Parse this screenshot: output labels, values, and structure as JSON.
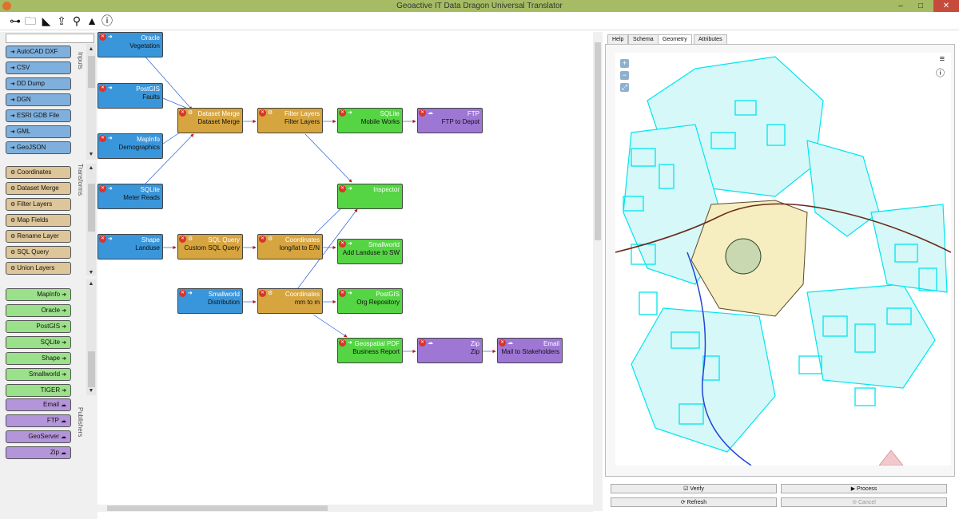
{
  "window": {
    "title": "Geoactive IT Data Dragon Universal Translator",
    "minimize": "–",
    "maximize": "□",
    "close": "✕"
  },
  "toolbar": {
    "icons": [
      "hierarchy-icon",
      "open-folder-icon",
      "eraser-icon",
      "upload-icon",
      "wrench-icon",
      "mortarboard-icon",
      "info-icon"
    ]
  },
  "palette": {
    "search_value": "",
    "inputs_label": "Inputs",
    "transforms_label": "Transforms",
    "publishers_label": "Publishers",
    "inputs": [
      "AutoCAD DXF",
      "CSV",
      "DD Dump",
      "DGN",
      "ESRI GDB File",
      "GML",
      "GeoJSON"
    ],
    "transforms": [
      "Coordinates",
      "Dataset Merge",
      "Filter Layers",
      "Map Fields",
      "Rename Layer",
      "SQL Query",
      "Union Layers"
    ],
    "outputs": [
      "MapInfo",
      "Oracle",
      "PostGIS",
      "SQLite",
      "Shape",
      "Smallworld",
      "TIGER"
    ],
    "publishers": [
      "Email",
      "FTP",
      "GeoServer",
      "Zip"
    ]
  },
  "workflow": {
    "nodes": [
      {
        "id": "oracle",
        "kind": "input",
        "type": "Oracle",
        "name": "Vegetation"
      },
      {
        "id": "postgis",
        "kind": "input",
        "type": "PostGIS",
        "name": "Faults"
      },
      {
        "id": "mapinfo",
        "kind": "input",
        "type": "MapInfo",
        "name": "Demographics"
      },
      {
        "id": "sqlite-in",
        "kind": "input",
        "type": "SQLite",
        "name": "Meter Reads"
      },
      {
        "id": "shape",
        "kind": "input",
        "type": "Shape",
        "name": "Landuse"
      },
      {
        "id": "merge",
        "kind": "transform",
        "type": "Dataset Merge",
        "name": "Dataset Merge"
      },
      {
        "id": "filter",
        "kind": "transform",
        "type": "Filter Layers",
        "name": "Filter Layers"
      },
      {
        "id": "sqlite-out",
        "kind": "output",
        "type": "SQLite",
        "name": "Mobile Works"
      },
      {
        "id": "ftp",
        "kind": "publisher",
        "type": "FTP",
        "name": "FTP to Depot"
      },
      {
        "id": "inspector",
        "kind": "output",
        "type": "Inspector",
        "name": ""
      },
      {
        "id": "sqlquery",
        "kind": "transform",
        "type": "SQL Query",
        "name": "Custom SQL Query"
      },
      {
        "id": "coord1",
        "kind": "transform",
        "type": "Coordinates",
        "name": "long/lat to E/N"
      },
      {
        "id": "sw-out",
        "kind": "output",
        "type": "Smallworld",
        "name": "Add Landuse to SW"
      },
      {
        "id": "sw-in",
        "kind": "input",
        "type": "Smallworld",
        "name": "Distribution"
      },
      {
        "id": "coord2",
        "kind": "transform",
        "type": "Coordinates",
        "name": "mm to m"
      },
      {
        "id": "pg-out",
        "kind": "output",
        "type": "PostGIS",
        "name": "Org Repository"
      },
      {
        "id": "pdf",
        "kind": "output",
        "type": "Geospatial PDF",
        "name": "Business Report"
      },
      {
        "id": "zip",
        "kind": "publisher",
        "type": "Zip",
        "name": "Zip"
      },
      {
        "id": "email",
        "kind": "publisher",
        "type": "Email",
        "name": "Mail to Stakeholders"
      }
    ]
  },
  "viewer": {
    "tabs": [
      "Help",
      "Schema",
      "Geometry",
      "Attributes"
    ],
    "active_tab": "Geometry",
    "zoom_in": "+",
    "zoom_out": "−",
    "zoom_extent": "⤢",
    "buttons": {
      "verify": "Verify",
      "process": "Process",
      "refresh": "Refresh",
      "cancel": "Cancel"
    }
  },
  "colors": {
    "input": "#3a96da",
    "transform": "#d6a53f",
    "output": "#55d444",
    "publisher": "#9e77d4",
    "map_parcels": "#00e5ef",
    "map_town": "#f6eec0"
  }
}
